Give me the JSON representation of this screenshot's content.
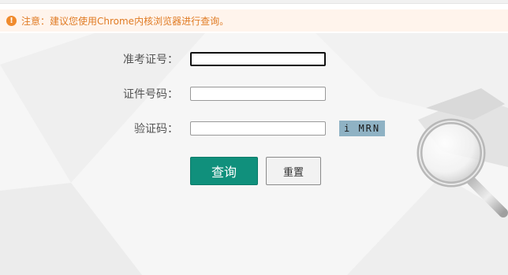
{
  "notice": {
    "text": "注意：建议您使用Chrome内核浏览器进行查询。",
    "icon": "exclamation-icon",
    "color": "#e07b24"
  },
  "form": {
    "exam_number_label": "准考证号：",
    "exam_number_value": "",
    "id_number_label": "证件号码：",
    "id_number_value": "",
    "captcha_label": "验证码：",
    "captcha_value": "",
    "captcha_image_text": "i MRN"
  },
  "buttons": {
    "query_label": "查询",
    "reset_label": "重置"
  },
  "colors": {
    "primary": "#10907c",
    "notice_bg": "#fff4ec",
    "panel_bg": "#f6f6f6"
  }
}
